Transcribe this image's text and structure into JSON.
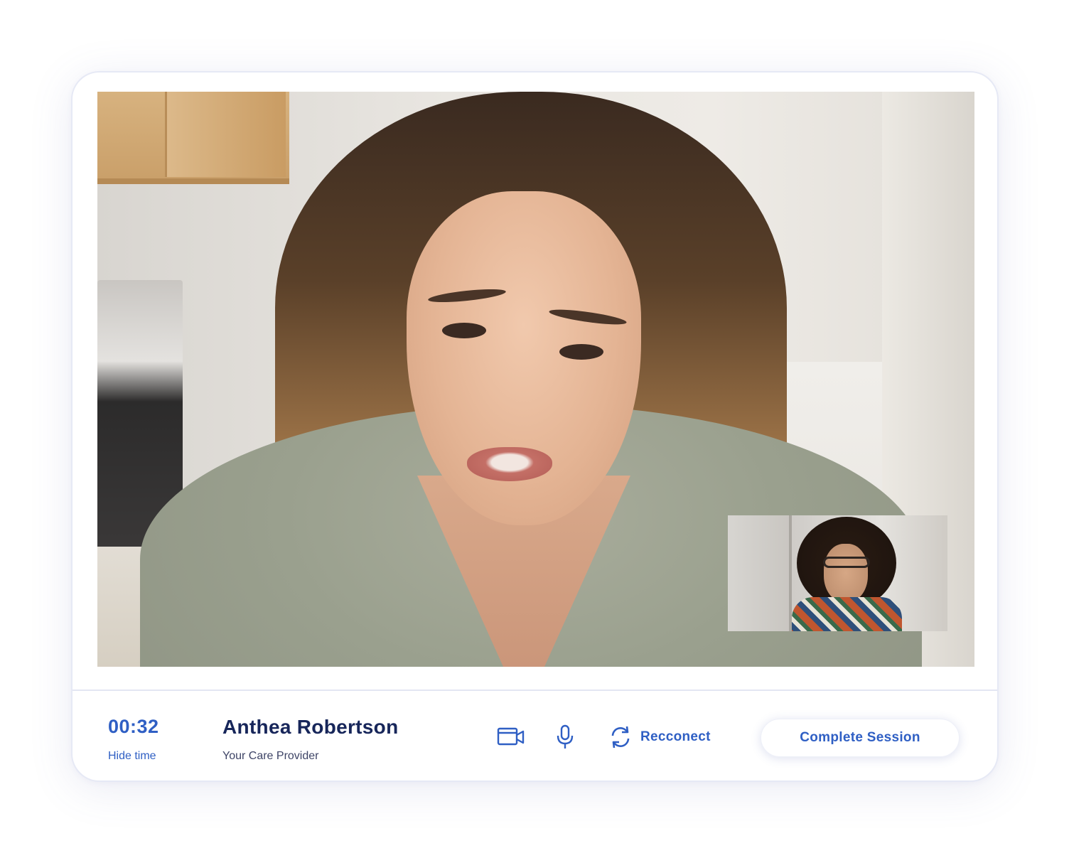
{
  "session": {
    "timer": "00:32",
    "hide_time_label": "Hide time"
  },
  "provider": {
    "name": "Anthea Robertson",
    "role": "Your Care Provider"
  },
  "controls": {
    "camera_icon": "video-camera-icon",
    "mic_icon": "microphone-icon",
    "reconnect_icon": "refresh-icon",
    "reconnect_label": "Recconect",
    "complete_label": "Complete Session"
  },
  "colors": {
    "accent": "#2f5fc4",
    "name_text": "#17265a",
    "card_border": "#e6e9f5"
  }
}
